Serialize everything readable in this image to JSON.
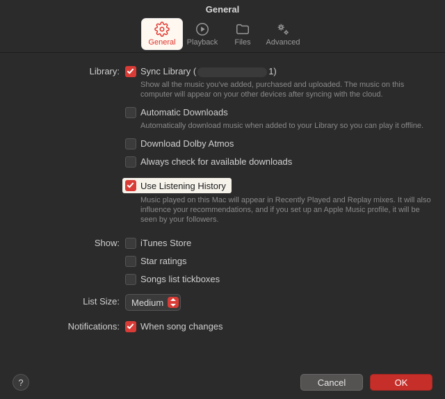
{
  "title": "General",
  "toolbar": {
    "general": "General",
    "playback": "Playback",
    "files": "Files",
    "advanced": "Advanced"
  },
  "labels": {
    "library": "Library:",
    "show": "Show:",
    "list_size": "List Size:",
    "notifications": "Notifications:"
  },
  "library": {
    "sync": {
      "label_prefix": "Sync Library  (",
      "label_suffix": "1)",
      "desc": "Show all the music you've added, purchased and uploaded. The music on this computer will appear on your other devices after syncing with the cloud."
    },
    "auto_dl": {
      "label": "Automatic Downloads",
      "desc": "Automatically download music when added to your Library so you can play it offline."
    },
    "dolby": {
      "label": "Download Dolby Atmos"
    },
    "check_dl": {
      "label": "Always check for available downloads"
    },
    "history": {
      "label": "Use Listening History",
      "desc": "Music played on this Mac will appear in Recently Played and Replay mixes. It will also influence your recommendations, and if you set up an Apple Music profile, it will be seen by your followers."
    }
  },
  "show": {
    "itunes": "iTunes Store",
    "stars": "Star ratings",
    "tickboxes": "Songs list tickboxes"
  },
  "list_size": {
    "value": "Medium"
  },
  "notifications": {
    "song_changes": "When song changes"
  },
  "footer": {
    "help": "?",
    "cancel": "Cancel",
    "ok": "OK"
  }
}
